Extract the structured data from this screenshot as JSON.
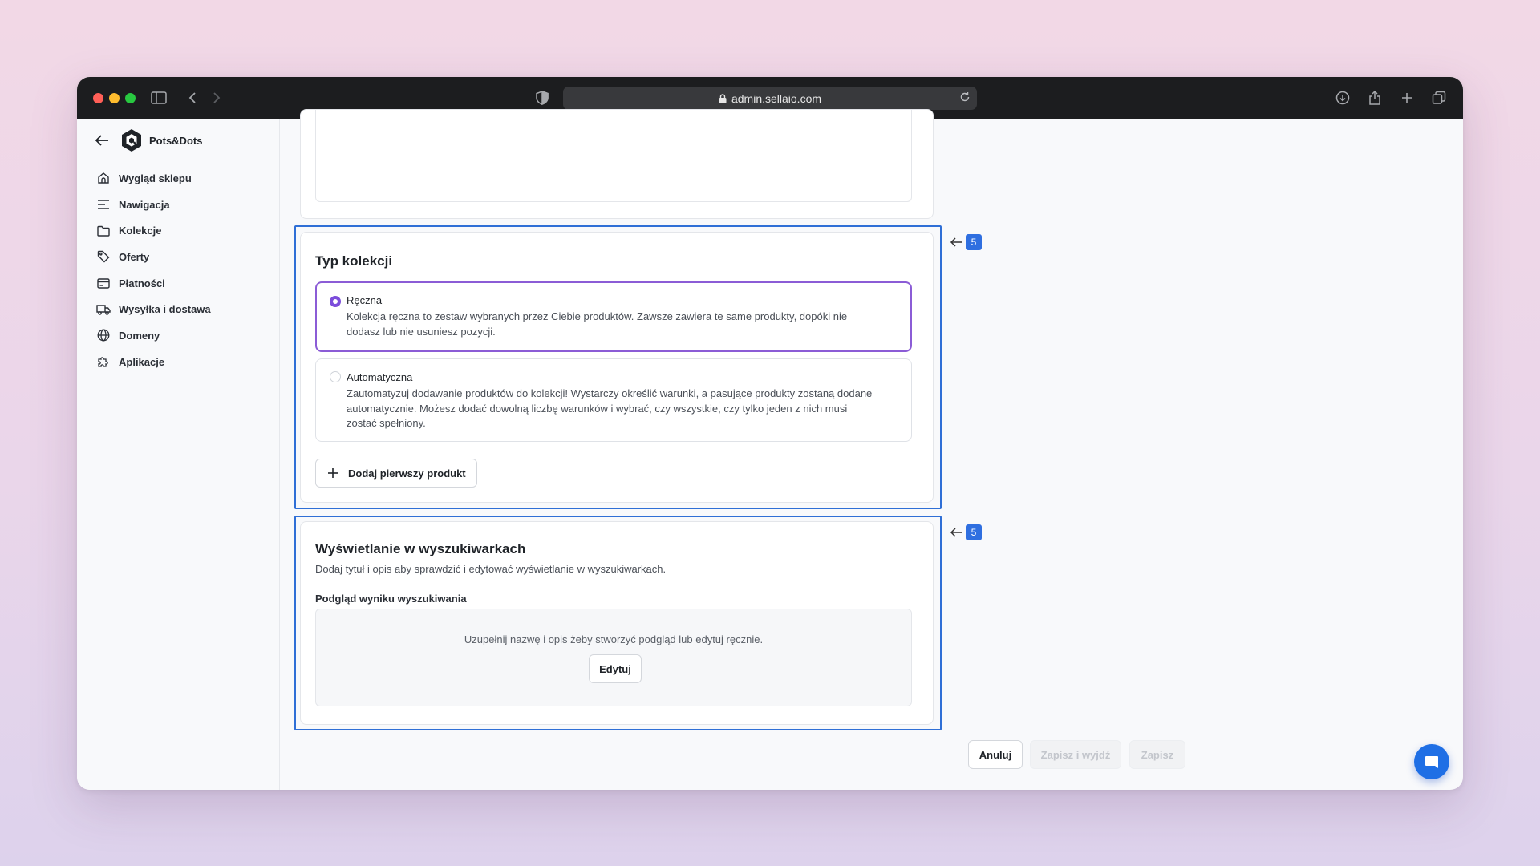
{
  "browser": {
    "url": "admin.sellaio.com"
  },
  "sidebar": {
    "brand": "Pots&Dots",
    "items": [
      {
        "label": "Wygląd sklepu",
        "icon": "home-icon"
      },
      {
        "label": "Nawigacja",
        "icon": "menu-lines-icon"
      },
      {
        "label": "Kolekcje",
        "icon": "folder-icon"
      },
      {
        "label": "Oferty",
        "icon": "tag-icon"
      },
      {
        "label": "Płatności",
        "icon": "credit-card-icon"
      },
      {
        "label": "Wysyłka i dostawa",
        "icon": "truck-icon"
      },
      {
        "label": "Domeny",
        "icon": "globe-icon"
      },
      {
        "label": "Aplikacje",
        "icon": "puzzle-icon"
      }
    ]
  },
  "collection_type": {
    "title": "Typ kolekcji",
    "marker": "5",
    "options": [
      {
        "title": "Ręczna",
        "description_lines": [
          "Kolekcja ręczna to zestaw wybranych przez Ciebie produktów. Zawsze zawiera te same produkty, dopóki nie",
          "dodasz lub nie usuniesz pozycji."
        ],
        "selected": true
      },
      {
        "title": "Automatyczna",
        "description_lines": [
          "Zautomatyzuj dodawanie produktów do kolekcji! Wystarczy określić warunki, a pasujące produkty zostaną dodane",
          "automatycznie. Możesz dodać dowolną liczbę warunków i wybrać, czy wszystkie, czy tylko jeden z nich musi",
          "zostać spełniony."
        ],
        "selected": false
      }
    ],
    "add_product_label": "Dodaj pierwszy produkt"
  },
  "seo": {
    "title": "Wyświetlanie w wyszukiwarkach",
    "marker": "5",
    "subtitle": "Dodaj tytuł i opis aby sprawdzić i edytować wyświetlanie w wyszukiwarkach.",
    "preview_label": "Podgląd wyniku wyszukiwania",
    "preview_text": "Uzupełnij nazwę i opis żeby stworzyć podgląd lub edytuj ręcznie.",
    "edit_label": "Edytuj"
  },
  "footer": {
    "cancel_label": "Anuluj",
    "save_exit_label": "Zapisz i wyjdź",
    "save_label": "Zapisz"
  },
  "colors": {
    "accent": "#7c4ddb",
    "highlight": "#2f6fd6",
    "chat": "#1f6fe5"
  }
}
